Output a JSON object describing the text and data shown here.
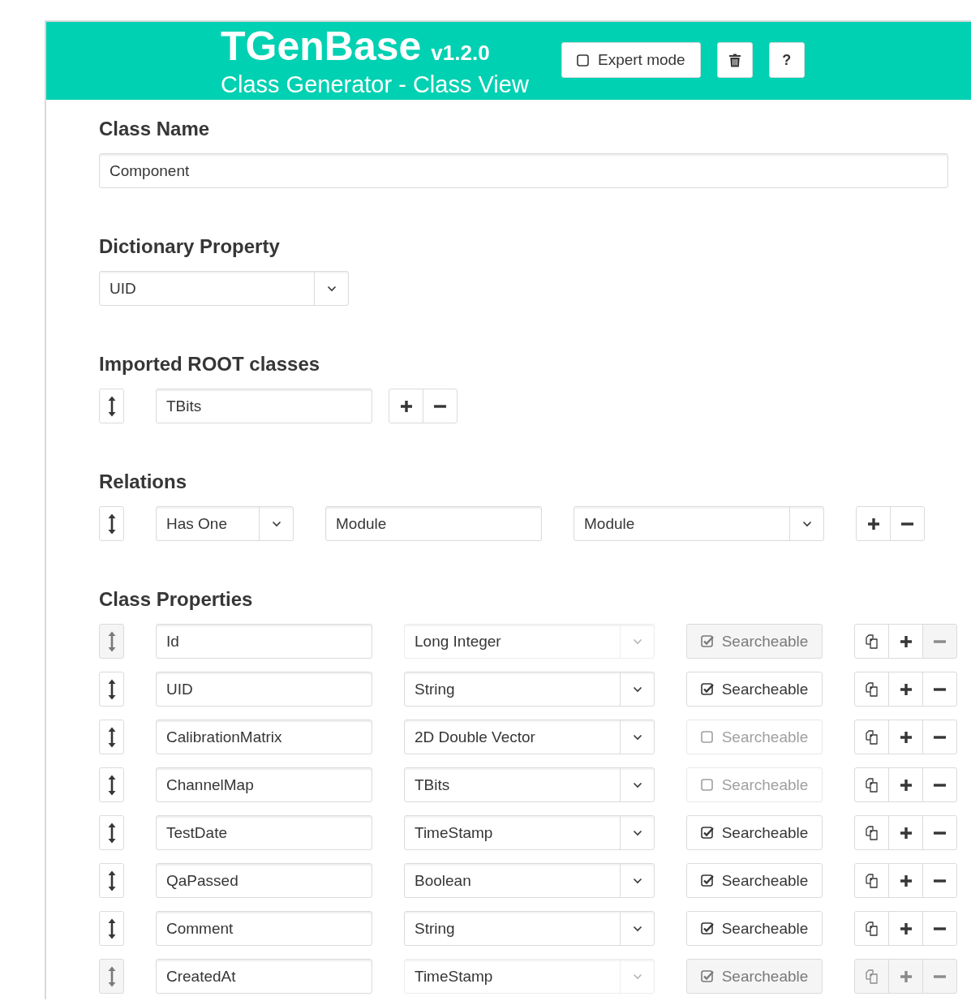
{
  "header": {
    "title": "TGenBase",
    "version": "v1.2.0",
    "subtitle": "Class Generator - Class View",
    "expert_mode": {
      "label": "Expert mode",
      "checked": false
    },
    "buttons": [
      {
        "kind": "trash"
      },
      {
        "kind": "help",
        "label": "?"
      }
    ]
  },
  "class_name": {
    "heading": "Class Name",
    "value": "Component"
  },
  "dictionary_property": {
    "heading": "Dictionary Property",
    "value": "UID"
  },
  "imported_root_classes": {
    "heading": "Imported ROOT classes",
    "items": [
      {
        "value": "TBits"
      }
    ]
  },
  "relations": {
    "heading": "Relations",
    "items": [
      {
        "type": "Has One",
        "name": "Module",
        "target": "Module"
      }
    ]
  },
  "class_properties": {
    "heading": "Class Properties",
    "items": [
      {
        "name": "Id",
        "type": "Long Integer",
        "locked": true,
        "add_locked": false,
        "searchable": {
          "label": "Searcheable",
          "checked": true
        }
      },
      {
        "name": "UID",
        "type": "String",
        "locked": false,
        "add_locked": false,
        "searchable": {
          "label": "Searcheable",
          "checked": true
        }
      },
      {
        "name": "CalibrationMatrix",
        "type": "2D Double Vector",
        "locked": false,
        "add_locked": false,
        "searchable": {
          "label": "Searcheable",
          "checked": false
        }
      },
      {
        "name": "ChannelMap",
        "type": "TBits",
        "locked": false,
        "add_locked": false,
        "searchable": {
          "label": "Searcheable",
          "checked": false
        }
      },
      {
        "name": "TestDate",
        "type": "TimeStamp",
        "locked": false,
        "add_locked": false,
        "searchable": {
          "label": "Searcheable",
          "checked": true
        }
      },
      {
        "name": "QaPassed",
        "type": "Boolean",
        "locked": false,
        "add_locked": false,
        "searchable": {
          "label": "Searcheable",
          "checked": true
        }
      },
      {
        "name": "Comment",
        "type": "String",
        "locked": false,
        "add_locked": false,
        "searchable": {
          "label": "Searcheable",
          "checked": true
        }
      },
      {
        "name": "CreatedAt",
        "type": "TimeStamp",
        "locked": true,
        "add_locked": true,
        "searchable": {
          "label": "Searcheable",
          "checked": true
        }
      }
    ]
  }
}
